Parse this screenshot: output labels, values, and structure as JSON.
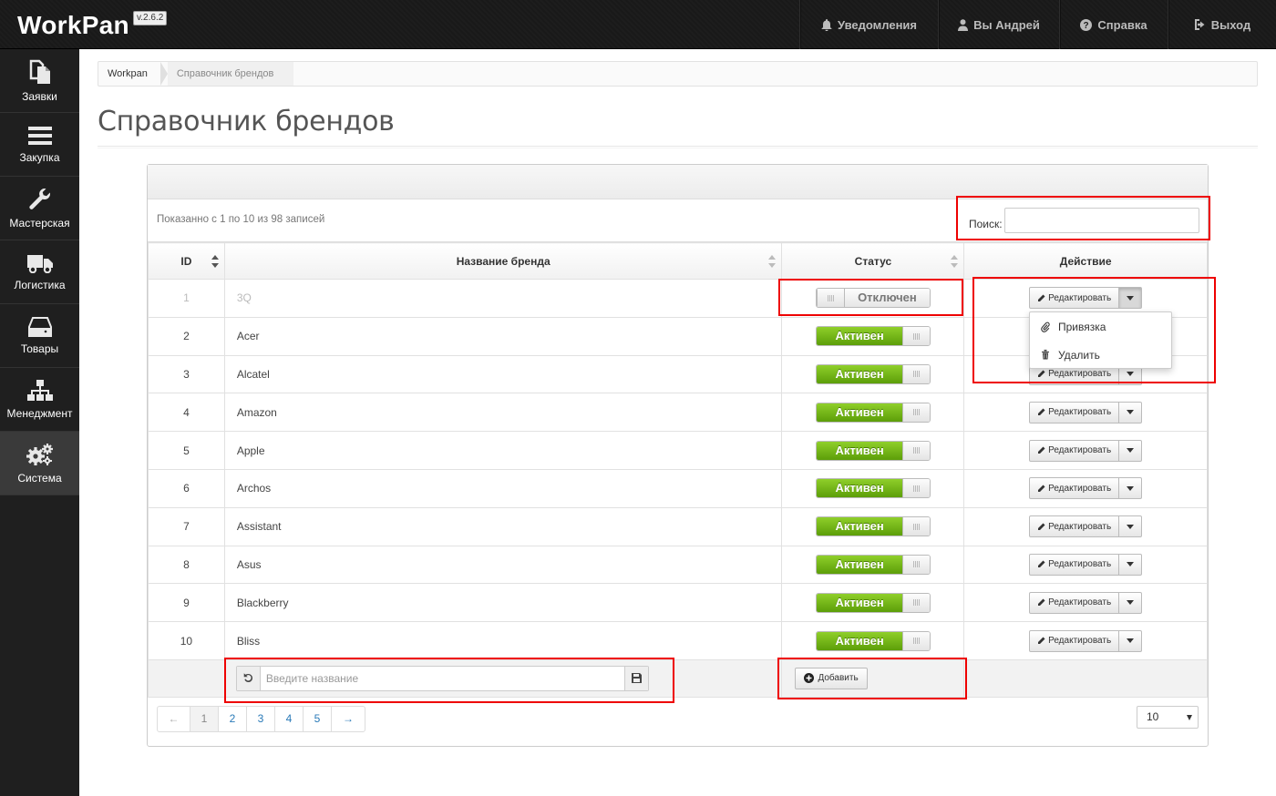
{
  "app": {
    "brand": "WorkPan",
    "version": "v.2.6.2"
  },
  "topnav": [
    {
      "label": "Уведомления",
      "icon": "bell-icon"
    },
    {
      "label": "Вы Андрей",
      "icon": "user-icon"
    },
    {
      "label": "Справка",
      "icon": "help-icon"
    },
    {
      "label": "Выход",
      "icon": "logout-icon"
    }
  ],
  "sidebar": [
    {
      "label": "Заявки",
      "icon": "documents-icon"
    },
    {
      "label": "Закупка",
      "icon": "menu-bars-icon"
    },
    {
      "label": "Мастерская",
      "icon": "wrench-icon"
    },
    {
      "label": "Логистика",
      "icon": "truck-icon"
    },
    {
      "label": "Товары",
      "icon": "hdd-icon"
    },
    {
      "label": "Менеджмент",
      "icon": "sitemap-icon"
    },
    {
      "label": "Система",
      "icon": "gears-icon"
    }
  ],
  "breadcrumb": {
    "root": "Workpan",
    "current": "Справочник брендов"
  },
  "page": {
    "title": "Справочник брендов"
  },
  "table_info": "Показанно с 1 по 10 из 98 записей",
  "search": {
    "label": "Поиск:",
    "value": ""
  },
  "columns": {
    "id": "ID",
    "name": "Название бренда",
    "status": "Статус",
    "action": "Действие"
  },
  "status_labels": {
    "active": "Активен",
    "disabled": "Отключен"
  },
  "edit_label": "Редактировать",
  "rows": [
    {
      "id": "1",
      "name": "3Q",
      "active": false
    },
    {
      "id": "2",
      "name": "Acer",
      "active": true
    },
    {
      "id": "3",
      "name": "Alcatel",
      "active": true
    },
    {
      "id": "4",
      "name": "Amazon",
      "active": true
    },
    {
      "id": "5",
      "name": "Apple",
      "active": true
    },
    {
      "id": "6",
      "name": "Archos",
      "active": true
    },
    {
      "id": "7",
      "name": "Assistant",
      "active": true
    },
    {
      "id": "8",
      "name": "Asus",
      "active": true
    },
    {
      "id": "9",
      "name": "Blackberry",
      "active": true
    },
    {
      "id": "10",
      "name": "Bliss",
      "active": true
    }
  ],
  "dropdown": {
    "link": "Привязка",
    "delete": "Удалить"
  },
  "add_form": {
    "placeholder": "Введите название",
    "button": "Добавить"
  },
  "pager": {
    "prev": "←",
    "next": "→",
    "pages": [
      "1",
      "2",
      "3",
      "4",
      "5"
    ],
    "current": "1"
  },
  "page_size": "10",
  "colors": {
    "active_green": "#6aab12",
    "highlight_red": "#ee0000"
  }
}
